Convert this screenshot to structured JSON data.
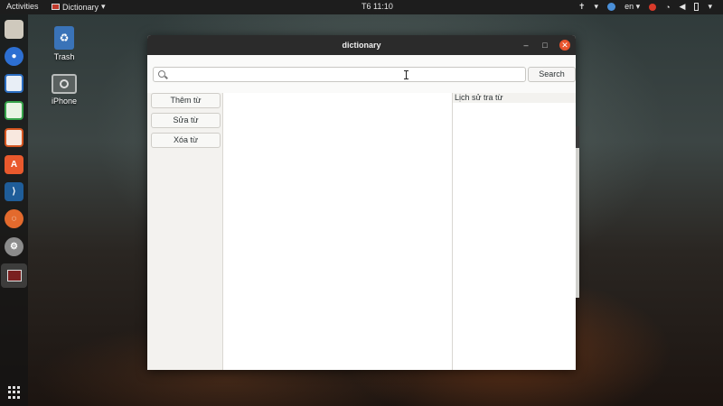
{
  "topbar": {
    "activities": "Activities",
    "app_name": "Dictionary",
    "clock": "T6 11:10",
    "language": "en",
    "tray_icons": [
      "accessibility-icon",
      "chrome-icon",
      "language-icon",
      "record-icon",
      "wifi-icon",
      "volume-icon",
      "battery-icon"
    ]
  },
  "dock": {
    "items": [
      "files-icon",
      "chromium-icon",
      "writer-icon",
      "calc-icon",
      "impress-icon",
      "software-center-icon",
      "vscode-icon",
      "ubuntu-icon",
      "settings-icon",
      "dictionary-app-icon"
    ],
    "show_apps_icon": "app-grid-icon"
  },
  "desktop": {
    "trash_label": "Trash",
    "iphone_label": "iPhone"
  },
  "window": {
    "title": "dictionary",
    "search": {
      "value": "",
      "placeholder": ""
    },
    "search_button": "Search",
    "actions": {
      "add": "Thêm từ",
      "edit": "Sửa từ",
      "delete": "Xóa từ"
    },
    "history": {
      "title": "Lịch sử tra từ",
      "items": []
    }
  },
  "colors": {
    "titlebar": "#2b2b2b",
    "close_button": "#e9542d",
    "window_bg": "#f6f5f4",
    "topbar": "#1d1d1d"
  }
}
